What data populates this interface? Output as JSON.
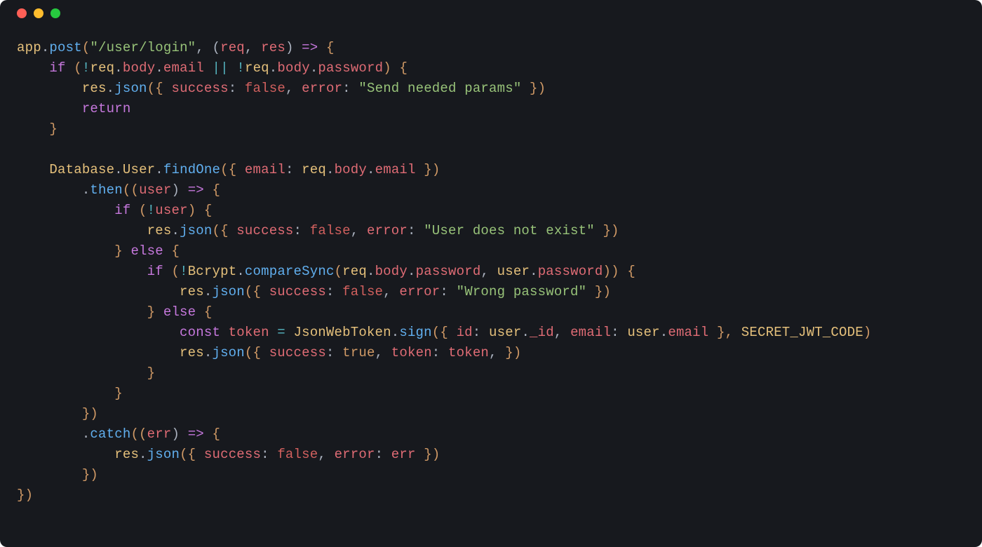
{
  "window": {
    "traffic_lights": [
      "close",
      "minimize",
      "zoom"
    ]
  },
  "code": {
    "tokens": [
      [
        {
          "t": "app",
          "c": "tok-obj"
        },
        {
          "t": ".",
          "c": "tok-punc"
        },
        {
          "t": "post",
          "c": "tok-func"
        },
        {
          "t": "(",
          "c": "tok-brace"
        },
        {
          "t": "\"/user/login\"",
          "c": "tok-str"
        },
        {
          "t": ", (",
          "c": "tok-punc"
        },
        {
          "t": "req",
          "c": "tok-param"
        },
        {
          "t": ", ",
          "c": "tok-punc"
        },
        {
          "t": "res",
          "c": "tok-param"
        },
        {
          "t": ") ",
          "c": "tok-punc"
        },
        {
          "t": "=>",
          "c": "tok-arrow"
        },
        {
          "t": " {",
          "c": "tok-brace"
        }
      ],
      [
        {
          "t": "    ",
          "c": "tok-plain"
        },
        {
          "t": "if",
          "c": "tok-kw"
        },
        {
          "t": " (",
          "c": "tok-brace"
        },
        {
          "t": "!",
          "c": "tok-op"
        },
        {
          "t": "req",
          "c": "tok-obj"
        },
        {
          "t": ".",
          "c": "tok-punc"
        },
        {
          "t": "body",
          "c": "tok-prop"
        },
        {
          "t": ".",
          "c": "tok-punc"
        },
        {
          "t": "email",
          "c": "tok-prop"
        },
        {
          "t": " || ",
          "c": "tok-op"
        },
        {
          "t": "!",
          "c": "tok-op"
        },
        {
          "t": "req",
          "c": "tok-obj"
        },
        {
          "t": ".",
          "c": "tok-punc"
        },
        {
          "t": "body",
          "c": "tok-prop"
        },
        {
          "t": ".",
          "c": "tok-punc"
        },
        {
          "t": "password",
          "c": "tok-prop"
        },
        {
          "t": ") {",
          "c": "tok-brace"
        }
      ],
      [
        {
          "t": "        ",
          "c": "tok-plain"
        },
        {
          "t": "res",
          "c": "tok-obj"
        },
        {
          "t": ".",
          "c": "tok-punc"
        },
        {
          "t": "json",
          "c": "tok-func"
        },
        {
          "t": "({ ",
          "c": "tok-brace"
        },
        {
          "t": "success",
          "c": "tok-key"
        },
        {
          "t": ": ",
          "c": "tok-punc"
        },
        {
          "t": "false",
          "c": "tok-false"
        },
        {
          "t": ", ",
          "c": "tok-punc"
        },
        {
          "t": "error",
          "c": "tok-key"
        },
        {
          "t": ": ",
          "c": "tok-punc"
        },
        {
          "t": "\"Send needed params\"",
          "c": "tok-str"
        },
        {
          "t": " })",
          "c": "tok-brace"
        }
      ],
      [
        {
          "t": "        ",
          "c": "tok-plain"
        },
        {
          "t": "return",
          "c": "tok-kw"
        }
      ],
      [
        {
          "t": "    }",
          "c": "tok-brace"
        }
      ],
      [
        {
          "t": "",
          "c": "tok-plain"
        }
      ],
      [
        {
          "t": "    ",
          "c": "tok-plain"
        },
        {
          "t": "Database",
          "c": "tok-obj"
        },
        {
          "t": ".",
          "c": "tok-punc"
        },
        {
          "t": "User",
          "c": "tok-obj"
        },
        {
          "t": ".",
          "c": "tok-punc"
        },
        {
          "t": "findOne",
          "c": "tok-func"
        },
        {
          "t": "({ ",
          "c": "tok-brace"
        },
        {
          "t": "email",
          "c": "tok-key"
        },
        {
          "t": ": ",
          "c": "tok-punc"
        },
        {
          "t": "req",
          "c": "tok-obj"
        },
        {
          "t": ".",
          "c": "tok-punc"
        },
        {
          "t": "body",
          "c": "tok-prop"
        },
        {
          "t": ".",
          "c": "tok-punc"
        },
        {
          "t": "email",
          "c": "tok-prop"
        },
        {
          "t": " })",
          "c": "tok-brace"
        }
      ],
      [
        {
          "t": "        .",
          "c": "tok-punc"
        },
        {
          "t": "then",
          "c": "tok-func"
        },
        {
          "t": "((",
          "c": "tok-brace"
        },
        {
          "t": "user",
          "c": "tok-param"
        },
        {
          "t": ") ",
          "c": "tok-punc"
        },
        {
          "t": "=>",
          "c": "tok-arrow"
        },
        {
          "t": " {",
          "c": "tok-brace"
        }
      ],
      [
        {
          "t": "            ",
          "c": "tok-plain"
        },
        {
          "t": "if",
          "c": "tok-kw"
        },
        {
          "t": " (",
          "c": "tok-brace"
        },
        {
          "t": "!",
          "c": "tok-op"
        },
        {
          "t": "user",
          "c": "tok-var"
        },
        {
          "t": ") {",
          "c": "tok-brace"
        }
      ],
      [
        {
          "t": "                ",
          "c": "tok-plain"
        },
        {
          "t": "res",
          "c": "tok-obj"
        },
        {
          "t": ".",
          "c": "tok-punc"
        },
        {
          "t": "json",
          "c": "tok-func"
        },
        {
          "t": "({ ",
          "c": "tok-brace"
        },
        {
          "t": "success",
          "c": "tok-key"
        },
        {
          "t": ": ",
          "c": "tok-punc"
        },
        {
          "t": "false",
          "c": "tok-false"
        },
        {
          "t": ", ",
          "c": "tok-punc"
        },
        {
          "t": "error",
          "c": "tok-key"
        },
        {
          "t": ": ",
          "c": "tok-punc"
        },
        {
          "t": "\"User does not exist\"",
          "c": "tok-str"
        },
        {
          "t": " })",
          "c": "tok-brace"
        }
      ],
      [
        {
          "t": "            } ",
          "c": "tok-brace"
        },
        {
          "t": "else",
          "c": "tok-kw"
        },
        {
          "t": " {",
          "c": "tok-brace"
        }
      ],
      [
        {
          "t": "                ",
          "c": "tok-plain"
        },
        {
          "t": "if",
          "c": "tok-kw"
        },
        {
          "t": " (",
          "c": "tok-brace"
        },
        {
          "t": "!",
          "c": "tok-op"
        },
        {
          "t": "Bcrypt",
          "c": "tok-obj"
        },
        {
          "t": ".",
          "c": "tok-punc"
        },
        {
          "t": "compareSync",
          "c": "tok-func"
        },
        {
          "t": "(",
          "c": "tok-brace"
        },
        {
          "t": "req",
          "c": "tok-obj"
        },
        {
          "t": ".",
          "c": "tok-punc"
        },
        {
          "t": "body",
          "c": "tok-prop"
        },
        {
          "t": ".",
          "c": "tok-punc"
        },
        {
          "t": "password",
          "c": "tok-prop"
        },
        {
          "t": ", ",
          "c": "tok-punc"
        },
        {
          "t": "user",
          "c": "tok-obj"
        },
        {
          "t": ".",
          "c": "tok-punc"
        },
        {
          "t": "password",
          "c": "tok-prop"
        },
        {
          "t": ")) {",
          "c": "tok-brace"
        }
      ],
      [
        {
          "t": "                    ",
          "c": "tok-plain"
        },
        {
          "t": "res",
          "c": "tok-obj"
        },
        {
          "t": ".",
          "c": "tok-punc"
        },
        {
          "t": "json",
          "c": "tok-func"
        },
        {
          "t": "({ ",
          "c": "tok-brace"
        },
        {
          "t": "success",
          "c": "tok-key"
        },
        {
          "t": ": ",
          "c": "tok-punc"
        },
        {
          "t": "false",
          "c": "tok-false"
        },
        {
          "t": ", ",
          "c": "tok-punc"
        },
        {
          "t": "error",
          "c": "tok-key"
        },
        {
          "t": ": ",
          "c": "tok-punc"
        },
        {
          "t": "\"Wrong password\"",
          "c": "tok-str"
        },
        {
          "t": " })",
          "c": "tok-brace"
        }
      ],
      [
        {
          "t": "                } ",
          "c": "tok-brace"
        },
        {
          "t": "else",
          "c": "tok-kw"
        },
        {
          "t": " {",
          "c": "tok-brace"
        }
      ],
      [
        {
          "t": "                    ",
          "c": "tok-plain"
        },
        {
          "t": "const",
          "c": "tok-kw"
        },
        {
          "t": " ",
          "c": "tok-plain"
        },
        {
          "t": "token",
          "c": "tok-var"
        },
        {
          "t": " = ",
          "c": "tok-op"
        },
        {
          "t": "JsonWebToken",
          "c": "tok-obj"
        },
        {
          "t": ".",
          "c": "tok-punc"
        },
        {
          "t": "sign",
          "c": "tok-func"
        },
        {
          "t": "({ ",
          "c": "tok-brace"
        },
        {
          "t": "id",
          "c": "tok-key"
        },
        {
          "t": ": ",
          "c": "tok-punc"
        },
        {
          "t": "user",
          "c": "tok-obj"
        },
        {
          "t": ".",
          "c": "tok-punc"
        },
        {
          "t": "_id",
          "c": "tok-prop"
        },
        {
          "t": ", ",
          "c": "tok-punc"
        },
        {
          "t": "email",
          "c": "tok-key"
        },
        {
          "t": ": ",
          "c": "tok-punc"
        },
        {
          "t": "user",
          "c": "tok-obj"
        },
        {
          "t": ".",
          "c": "tok-punc"
        },
        {
          "t": "email",
          "c": "tok-prop"
        },
        {
          "t": " }, ",
          "c": "tok-brace"
        },
        {
          "t": "SECRET_JWT_CODE",
          "c": "tok-const"
        },
        {
          "t": ")",
          "c": "tok-brace"
        }
      ],
      [
        {
          "t": "                    ",
          "c": "tok-plain"
        },
        {
          "t": "res",
          "c": "tok-obj"
        },
        {
          "t": ".",
          "c": "tok-punc"
        },
        {
          "t": "json",
          "c": "tok-func"
        },
        {
          "t": "({ ",
          "c": "tok-brace"
        },
        {
          "t": "success",
          "c": "tok-key"
        },
        {
          "t": ": ",
          "c": "tok-punc"
        },
        {
          "t": "true",
          "c": "tok-true"
        },
        {
          "t": ", ",
          "c": "tok-punc"
        },
        {
          "t": "token",
          "c": "tok-key"
        },
        {
          "t": ": ",
          "c": "tok-punc"
        },
        {
          "t": "token",
          "c": "tok-var"
        },
        {
          "t": ", ",
          "c": "tok-punc"
        },
        {
          "t": "})",
          "c": "tok-brace"
        }
      ],
      [
        {
          "t": "                }",
          "c": "tok-brace"
        }
      ],
      [
        {
          "t": "            }",
          "c": "tok-brace"
        }
      ],
      [
        {
          "t": "        })",
          "c": "tok-brace"
        }
      ],
      [
        {
          "t": "        .",
          "c": "tok-punc"
        },
        {
          "t": "catch",
          "c": "tok-func"
        },
        {
          "t": "((",
          "c": "tok-brace"
        },
        {
          "t": "err",
          "c": "tok-param"
        },
        {
          "t": ") ",
          "c": "tok-punc"
        },
        {
          "t": "=>",
          "c": "tok-arrow"
        },
        {
          "t": " {",
          "c": "tok-brace"
        }
      ],
      [
        {
          "t": "            ",
          "c": "tok-plain"
        },
        {
          "t": "res",
          "c": "tok-obj"
        },
        {
          "t": ".",
          "c": "tok-punc"
        },
        {
          "t": "json",
          "c": "tok-func"
        },
        {
          "t": "({ ",
          "c": "tok-brace"
        },
        {
          "t": "success",
          "c": "tok-key"
        },
        {
          "t": ": ",
          "c": "tok-punc"
        },
        {
          "t": "false",
          "c": "tok-false"
        },
        {
          "t": ", ",
          "c": "tok-punc"
        },
        {
          "t": "error",
          "c": "tok-key"
        },
        {
          "t": ": ",
          "c": "tok-punc"
        },
        {
          "t": "err",
          "c": "tok-var"
        },
        {
          "t": " })",
          "c": "tok-brace"
        }
      ],
      [
        {
          "t": "        })",
          "c": "tok-brace"
        }
      ],
      [
        {
          "t": "})",
          "c": "tok-brace"
        }
      ]
    ]
  }
}
